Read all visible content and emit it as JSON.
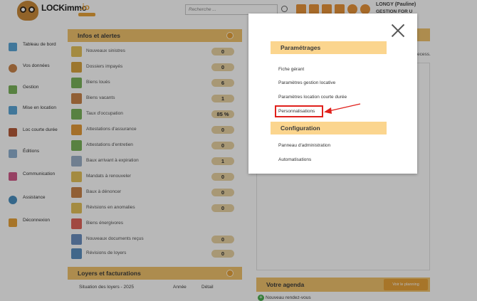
{
  "header": {
    "logo_text": "LOCKimmo",
    "logo_suffix": ".io",
    "search_placeholder": "Recherche ...",
    "user_name": "LONGY (Pauline)",
    "user_company": "GESTION FOR U",
    "icons": [
      "home-icon",
      "edit-icon",
      "document-icon",
      "tree-icon",
      "gear-icon",
      "power-icon"
    ]
  },
  "sidebar": {
    "items": [
      {
        "label": "Tableau de bord",
        "icon": "dashboard-icon"
      },
      {
        "label": "Vos données",
        "icon": "user-icon"
      },
      {
        "label": "Gestion",
        "icon": "management-icon"
      },
      {
        "label": "Mise en location",
        "icon": "rental-icon"
      },
      {
        "label": "Loc courte durée",
        "icon": "short-stay-icon"
      },
      {
        "label": "Éditions",
        "icon": "print-icon"
      },
      {
        "label": "Communication",
        "icon": "communication-icon"
      },
      {
        "label": "Assistance",
        "icon": "support-icon"
      },
      {
        "label": "Déconnexion",
        "icon": "logout-icon"
      }
    ]
  },
  "alerts": {
    "title": "Infos et alertes",
    "rows": [
      {
        "label": "Nouveaux sinistres",
        "value": "0"
      },
      {
        "label": "Dossiers impayés",
        "value": "0"
      },
      {
        "label": "Biens loués",
        "value": "6"
      },
      {
        "label": "Biens vacants",
        "value": "1"
      },
      {
        "label": "Taux d'occupation",
        "value": "85 %"
      },
      {
        "label": "Attestations d'assurance",
        "value": "0"
      },
      {
        "label": "Attestations d'entretien",
        "value": "0"
      },
      {
        "label": "Baux arrivant à expiration",
        "value": "1"
      },
      {
        "label": "Mandats à renouveler",
        "value": "0"
      },
      {
        "label": "Baux à dénoncer",
        "value": "0"
      },
      {
        "label": "Révisions en anomalies",
        "value": "0"
      },
      {
        "label": "Biens énergivores",
        "value": ""
      },
      {
        "label": "Nouveaux documents reçus",
        "value": "0"
      },
      {
        "label": "Révisions de loyers",
        "value": "0"
      }
    ]
  },
  "loyers": {
    "title": "Loyers et facturations",
    "row_label": "Situation des loyers - 2025",
    "col_year": "Année",
    "col_detail": "Détail"
  },
  "right": {
    "note": "ecess."
  },
  "agenda": {
    "title": "Votre agenda",
    "button": "Voir le planning",
    "new_label": "Nouveau rendez-vous"
  },
  "modal": {
    "sections": [
      {
        "title": "Paramétrages",
        "links": [
          "Fiche gérant",
          "Paramètres gestion locative",
          "Paramètres location courte durée",
          "Personnalisations"
        ]
      },
      {
        "title": "Configuration",
        "links": [
          "Panneau d'administration",
          "Automatisations"
        ]
      }
    ]
  },
  "colors": {
    "accent": "#f0c36d",
    "highlight": "#e0201b"
  }
}
